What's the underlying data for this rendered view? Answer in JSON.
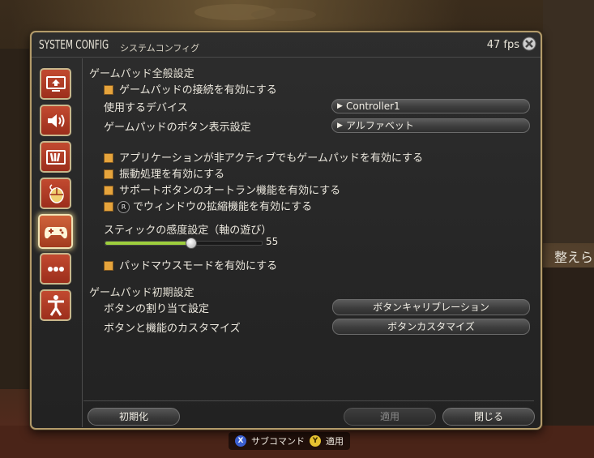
{
  "window": {
    "title": "SYSTEM CONFIG",
    "subtitle": "システムコンフィグ",
    "fps": "47 fps"
  },
  "sidebar": {
    "items": [
      {
        "icon": "display-settings-icon",
        "active": false
      },
      {
        "icon": "sound-icon",
        "active": false
      },
      {
        "icon": "hotbar-icon",
        "active": false
      },
      {
        "icon": "mouse-icon",
        "active": false
      },
      {
        "icon": "gamepad-icon",
        "active": true
      },
      {
        "icon": "other-settings-icon",
        "active": false
      },
      {
        "icon": "accessibility-icon",
        "active": false
      }
    ]
  },
  "general": {
    "heading": "ゲームパッド全般設定",
    "enable_connection": {
      "label": "ゲームパッドの接続を有効にする",
      "checked": true
    },
    "device": {
      "label": "使用するデバイス",
      "value": "Controller1"
    },
    "button_display": {
      "label": "ゲームパッドのボタン表示設定",
      "value": "アルファベット"
    },
    "checkboxes": [
      {
        "label": "アプリケーションが非アクティブでもゲームパッドを有効にする",
        "checked": true
      },
      {
        "label": "振動処理を有効にする",
        "checked": true
      },
      {
        "label": "サポートボタンのオートラン機能を有効にする",
        "checked": true
      },
      {
        "badge": "R",
        "label": "でウィンドウの拡縮機能を有効にする",
        "checked": true
      }
    ],
    "stick": {
      "label": "スティックの感度設定（軸の遊び）",
      "value": 55,
      "max": 100
    },
    "pad_mouse": {
      "label": "パッドマウスモードを有効にする",
      "checked": true
    }
  },
  "initial": {
    "heading": "ゲームパッド初期設定",
    "assign": {
      "label": "ボタンの割り当て設定",
      "button": "ボタンキャリブレーション"
    },
    "customize": {
      "label": "ボタンと機能のカスタマイズ",
      "button": "ボタンカスタマイズ"
    }
  },
  "footer": {
    "reset": "初期化",
    "apply": "適用",
    "close": "閉じる"
  },
  "hints": {
    "x_key": "X",
    "x_label": "サブコマンド",
    "y_key": "Y",
    "y_label": "適用"
  },
  "background": {
    "side_text": "整えら"
  },
  "colors": {
    "accent": "#e6a43c",
    "slider": "#9ecf3d",
    "sidebar_button": "#b23c26",
    "frame": "#b39b6a"
  }
}
